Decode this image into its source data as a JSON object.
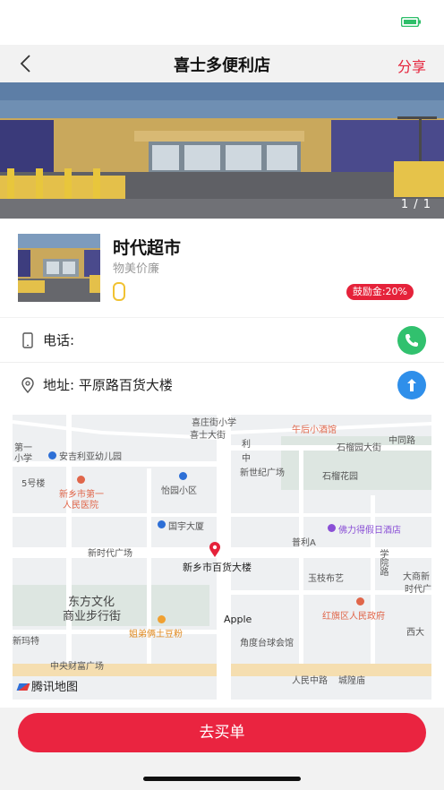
{
  "nav": {
    "title": "喜士多便利店",
    "share_label": "分享"
  },
  "banner": {
    "counter": "1 / 1"
  },
  "store": {
    "name": "时代超市",
    "slogan": "物美价廉",
    "reward_badge": "鼓励金:20%"
  },
  "phone": {
    "label": "电话:"
  },
  "address": {
    "label": "地址:",
    "value": "平原路百货大楼"
  },
  "map": {
    "labels": {
      "l01": "喜庄街小学",
      "l02": "喜士大街",
      "l03": "午后小酒馆",
      "l04": "中同路",
      "l05": "石榴园大街",
      "l06": "第一",
      "l07": "小学",
      "l08": "安吉利亚幼儿园",
      "l09": "利",
      "l10": "中",
      "l11": "新世纪广场",
      "l12": "石榴花园",
      "l13": "5号楼",
      "l14": "新乡市第一",
      "l15": "人民医院",
      "l16": "怡园小区",
      "l17": "国宇大厦",
      "l18": "佛力得假日酒店",
      "l19": "普利A",
      "l20": "新时代广场",
      "l21": "新乡市百货大楼",
      "l22": "玉枝布艺",
      "l23": "大商新",
      "l24": "时代广",
      "l25": "东方文化",
      "l26": "商业步行街",
      "l27": "Apple",
      "l28": "红旗区人民政府",
      "l29": "姐弟俩土豆粉",
      "l30": "角度台球会馆",
      "l31": "西大",
      "l32": "新玛特",
      "l33": "中央财富广场",
      "l34": "人民中路",
      "l35": "城隍庙",
      "l36": "学院路"
    },
    "logo_text": "腾讯地图"
  },
  "action": {
    "buy_label": "去买单"
  }
}
